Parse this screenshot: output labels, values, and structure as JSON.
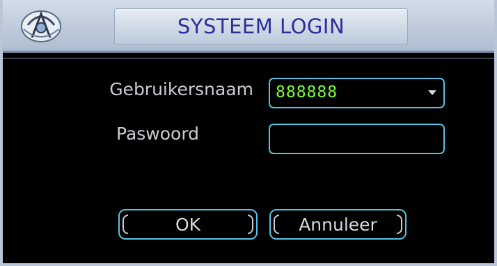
{
  "dialog": {
    "title": "SYSTEEM LOGIN",
    "logo_icon": "dvr-logo-icon"
  },
  "form": {
    "username_label": "Gebruikersnaam",
    "username_value": "888888",
    "password_label": "Paswoord",
    "password_value": ""
  },
  "buttons": {
    "ok_label": "OK",
    "cancel_label": "Annuleer"
  },
  "colors": {
    "title_text": "#2a2f9c",
    "field_border": "#52c4e8",
    "value_text": "#7aff3a",
    "label_text": "#c9cdd2"
  }
}
